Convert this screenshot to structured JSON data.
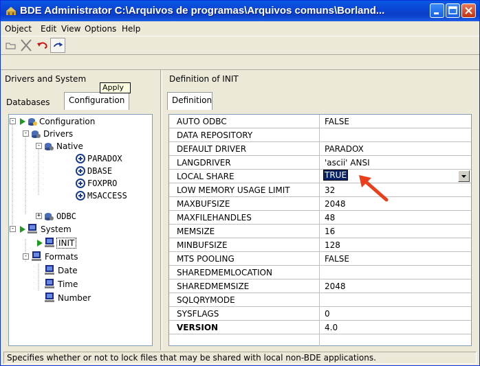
{
  "window": {
    "title": "BDE Administrator  C:\\Arquivos de programas\\Arquivos comuns\\Borland..."
  },
  "menu": [
    "Object",
    "Edit",
    "View",
    "Options",
    "Help"
  ],
  "left_pane": {
    "header": "Drivers and System",
    "tooltip": "Apply",
    "tabs": [
      "Databases",
      "Configuration"
    ],
    "active_tab": "Configuration"
  },
  "right_pane": {
    "header": "Definition of INIT",
    "tab": "Definition"
  },
  "tree": [
    {
      "label": "Configuration",
      "expander": "-",
      "icon": "config-icon"
    },
    {
      "label": "Drivers",
      "expander": "-",
      "icon": "drivers-icon"
    },
    {
      "label": "Native",
      "expander": "-",
      "icon": "drivers-icon"
    },
    {
      "label": "PARADOX",
      "icon": "driver-icon"
    },
    {
      "label": "DBASE",
      "icon": "driver-icon"
    },
    {
      "label": "FOXPRO",
      "icon": "driver-icon"
    },
    {
      "label": "MSACCESS",
      "icon": "driver-icon"
    },
    {
      "label": "ODBC",
      "expander": "+",
      "icon": "drivers-icon"
    },
    {
      "label": "System",
      "expander": "-",
      "icon": "computer-icon"
    },
    {
      "label": "INIT",
      "icon": "computer-icon",
      "selected": true
    },
    {
      "label": "Formats",
      "expander": "-",
      "icon": "computer-icon"
    },
    {
      "label": "Date",
      "icon": "computer-icon"
    },
    {
      "label": "Time",
      "icon": "computer-icon"
    },
    {
      "label": "Number",
      "icon": "computer-icon"
    }
  ],
  "definition": [
    {
      "name": "AUTO ODBC",
      "value": "FALSE"
    },
    {
      "name": "DATA REPOSITORY",
      "value": ""
    },
    {
      "name": "DEFAULT DRIVER",
      "value": "PARADOX"
    },
    {
      "name": "LANGDRIVER",
      "value": "'ascii' ANSI"
    },
    {
      "name": "LOCAL SHARE",
      "value": "TRUE"
    },
    {
      "name": "LOW MEMORY USAGE LIMIT",
      "value": "32"
    },
    {
      "name": "MAXBUFSIZE",
      "value": "2048"
    },
    {
      "name": "MAXFILEHANDLES",
      "value": "48"
    },
    {
      "name": "MEMSIZE",
      "value": "16"
    },
    {
      "name": "MINBUFSIZE",
      "value": "128"
    },
    {
      "name": "MTS POOLING",
      "value": "FALSE"
    },
    {
      "name": "SHAREDMEMLOCATION",
      "value": ""
    },
    {
      "name": "SHAREDMEMSIZE",
      "value": "2048"
    },
    {
      "name": "SQLQRYMODE",
      "value": ""
    },
    {
      "name": "SYSFLAGS",
      "value": "0"
    },
    {
      "name": "VERSION",
      "value": "4.0"
    }
  ],
  "status": "Specifies whether or not to lock files that may be shared with local non-BDE applications.",
  "colors": {
    "titlebar": "#0a46d3",
    "selection": "#0a246a",
    "arrow": "#e8401c"
  }
}
